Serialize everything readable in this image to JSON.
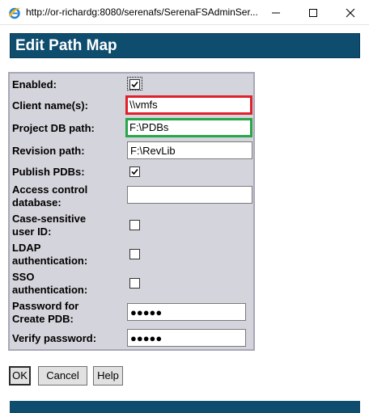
{
  "window": {
    "url": "http://or-richardg:8080/serenafs/SerenaFSAdminSer...",
    "icons": [
      "ie-icon",
      "minimize-icon",
      "maximize-icon",
      "close-icon"
    ]
  },
  "page": {
    "title": "Edit Path Map"
  },
  "form": {
    "enabled_label": "Enabled:",
    "enabled_checked": true,
    "client_name_label": "Client name(s):",
    "client_name_value": "\\\\vmfs",
    "project_db_label": "Project DB path:",
    "project_db_value": "F:\\PDBs",
    "revision_label": "Revision path:",
    "revision_value": "F:\\RevLib",
    "publish_label": "Publish PDBs:",
    "publish_checked": true,
    "access_label_1": "Access control",
    "access_label_2": "database:",
    "access_value": "",
    "case_label_1": "Case-sensitive",
    "case_label_2": "user ID:",
    "case_checked": false,
    "ldap_label_1": "LDAP",
    "ldap_label_2": "authentication:",
    "ldap_checked": false,
    "sso_label_1": "SSO",
    "sso_label_2": "authentication:",
    "sso_checked": false,
    "password_label_1": "Password for",
    "password_label_2": "Create PDB:",
    "password_value": "●●●●●",
    "verify_label": "Verify password:",
    "verify_value": "●●●●●"
  },
  "buttons": {
    "ok": "OK",
    "cancel": "Cancel",
    "help": "Help"
  },
  "colors": {
    "header_bg": "#0f4d6f",
    "panel_bg": "#d4d4dc",
    "highlight_red": "#e0202a",
    "highlight_green": "#27a64a"
  }
}
